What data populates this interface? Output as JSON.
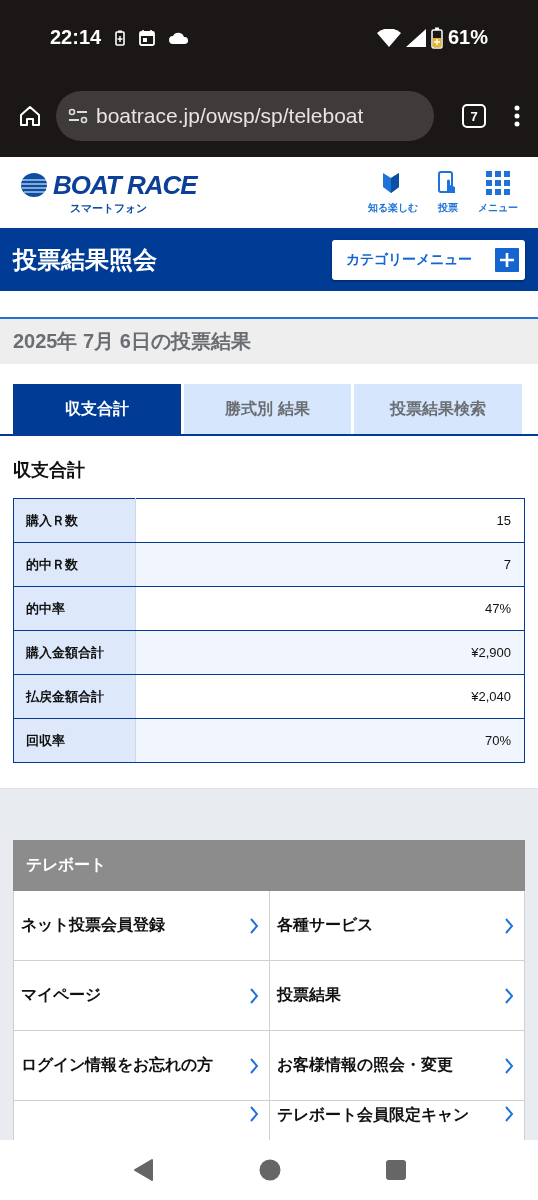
{
  "status_bar": {
    "time": "22:14",
    "battery": "61%"
  },
  "browser": {
    "url": "boatrace.jp/owsp/sp/teleboat",
    "tab_count": "7"
  },
  "header": {
    "logo": "BOAT RACE",
    "logo_sub": "スマートフォン",
    "nav": [
      {
        "label": "知る楽しむ",
        "kind": "beginner"
      },
      {
        "label": "投票",
        "kind": "phone"
      },
      {
        "label": "メニュー",
        "kind": "grid"
      }
    ]
  },
  "title_bar": {
    "title": "投票結果照会",
    "category_button": "カテゴリーメニュー"
  },
  "date_heading": "2025年 7月 6日の投票結果",
  "tabs": [
    {
      "label": "収支合計",
      "selected": true
    },
    {
      "label": "勝式別 結果",
      "selected": false
    },
    {
      "label": "投票結果検索",
      "selected": false
    }
  ],
  "summary": {
    "heading": "収支合計",
    "rows": [
      {
        "label": "購入Ｒ数",
        "value": "15"
      },
      {
        "label": "的中Ｒ数",
        "value": "7"
      },
      {
        "label": "的中率",
        "value": "47%"
      },
      {
        "label": "購入金額合計",
        "value": "¥2,900"
      },
      {
        "label": "払戻金額合計",
        "value": "¥2,040"
      },
      {
        "label": "回収率",
        "value": "70%"
      }
    ]
  },
  "teleboat": {
    "heading": "テレボート",
    "links": [
      {
        "label": "ネット投票会員登録",
        "arrow": true
      },
      {
        "label": "各種サービス",
        "arrow": true
      },
      {
        "label": "マイページ",
        "arrow": true
      },
      {
        "label": "投票結果",
        "arrow": true
      },
      {
        "label": "ログイン情報をお忘れの方",
        "arrow": true
      },
      {
        "label": "お客様情報の照会・変更",
        "arrow": true
      },
      {
        "arrow": true
      },
      {
        "label": "テレボート会員限定キャン",
        "arrow": true
      }
    ]
  }
}
